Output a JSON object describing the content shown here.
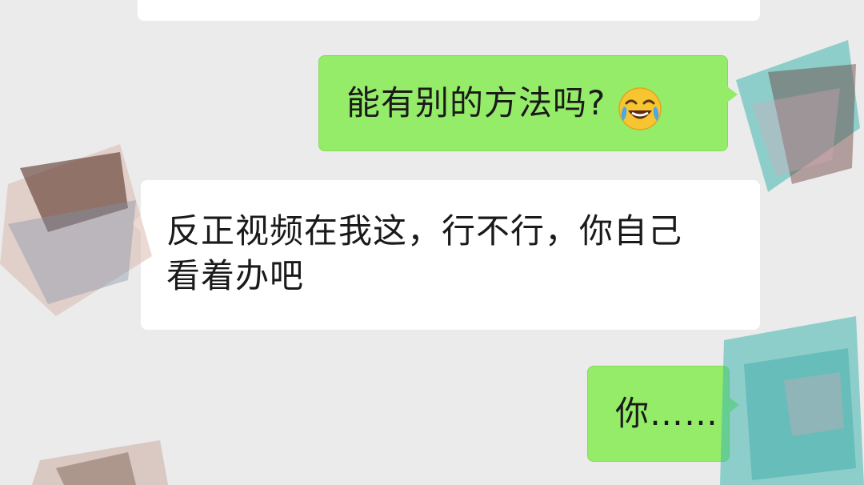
{
  "messages": [
    {
      "id": 0,
      "side": "in",
      "text": ""
    },
    {
      "id": 1,
      "side": "out",
      "text": "能有别的方法吗?",
      "emoji": "crying-laughing-emoji"
    },
    {
      "id": 2,
      "side": "in",
      "text": "反正视频在我这，行不行，你自己\n看着办吧"
    },
    {
      "id": 3,
      "side": "out",
      "text": "你……"
    }
  ],
  "colors": {
    "background": "#ebebeb",
    "incoming_bubble": "#ffffff",
    "outgoing_bubble": "#95ec69",
    "text": "#1a1a1a",
    "censor_teal": "#3fb6b0",
    "censor_brown": "#7a4e3c"
  }
}
